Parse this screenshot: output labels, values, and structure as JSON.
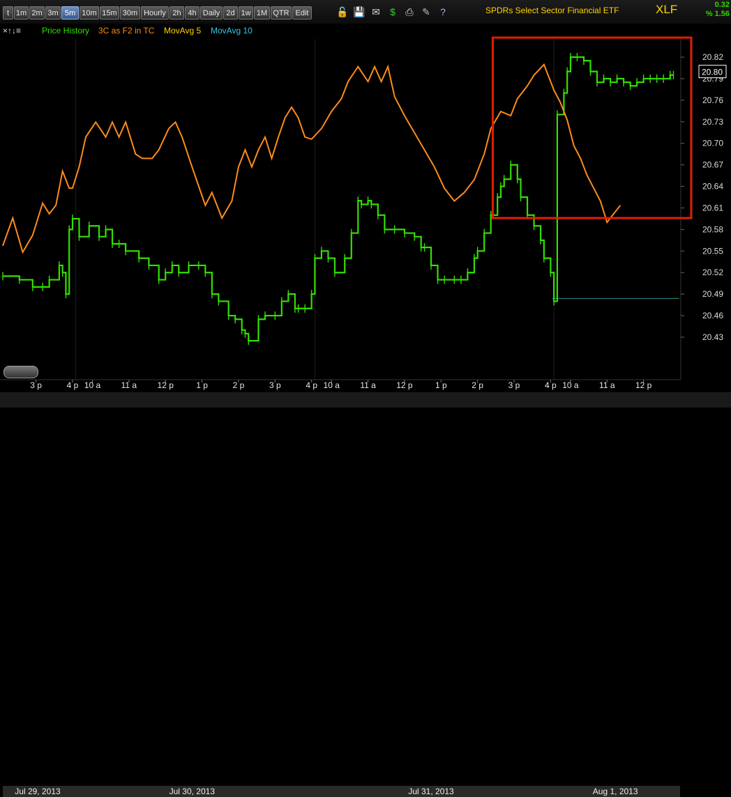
{
  "toolbar": {
    "timeframes": [
      "t",
      "1m",
      "2m",
      "3m",
      "5m",
      "10m",
      "15m",
      "30m",
      "Hourly",
      "2h",
      "4h",
      "Daily",
      "2d",
      "1w",
      "1M",
      "QTR",
      "Edit"
    ],
    "active": "5m",
    "icons": [
      "lock-icon",
      "save-icon",
      "mail-icon",
      "dollar-icon",
      "print-icon",
      "annotate-icon",
      "help-icon"
    ]
  },
  "header": {
    "title": "SPDRs Select Sector Financial ETF",
    "ticker": "XLF",
    "change": "0.32",
    "change_pct": "% 1.56"
  },
  "legend": {
    "items": [
      {
        "label": "Price History",
        "color": "#33e000"
      },
      {
        "label": "3C as F2 in TC",
        "color": "#ff8c1a"
      },
      {
        "label": "MovAvg 5",
        "color": "#ffd400"
      },
      {
        "label": "MovAvg 10",
        "color": "#36c8e8"
      }
    ]
  },
  "chart_data": {
    "type": "line",
    "price_axis": {
      "ticks": [
        "20.82",
        "20.79",
        "20.76",
        "20.73",
        "20.70",
        "20.67",
        "20.64",
        "20.61",
        "20.58",
        "20.55",
        "20.52",
        "20.49",
        "20.46",
        "20.43"
      ],
      "tick_values": [
        20.82,
        20.79,
        20.76,
        20.73,
        20.7,
        20.67,
        20.64,
        20.61,
        20.58,
        20.55,
        20.52,
        20.49,
        20.46,
        20.43
      ],
      "last_price": "20.80",
      "last_value": 20.8,
      "ylim": [
        20.4,
        20.84
      ]
    },
    "time_axis": {
      "ticks": [
        {
          "label": "3 p",
          "i": 10
        },
        {
          "label": "4 p",
          "i": 21
        },
        {
          "label": "10 a",
          "i": 27
        },
        {
          "label": "11 a",
          "i": 38
        },
        {
          "label": "12 p",
          "i": 49
        },
        {
          "label": "1 p",
          "i": 60
        },
        {
          "label": "2 p",
          "i": 71
        },
        {
          "label": "3 p",
          "i": 82
        },
        {
          "label": "4 p",
          "i": 93
        },
        {
          "label": "10 a",
          "i": 99
        },
        {
          "label": "11 a",
          "i": 110
        },
        {
          "label": "12 p",
          "i": 121
        },
        {
          "label": "1 p",
          "i": 132
        },
        {
          "label": "2 p",
          "i": 143
        },
        {
          "label": "3 p",
          "i": 154
        },
        {
          "label": "4 p",
          "i": 165
        },
        {
          "label": "10 a",
          "i": 171
        },
        {
          "label": "11 a",
          "i": 182
        },
        {
          "label": "12 p",
          "i": 193
        }
      ],
      "session_start_i": [
        22,
        94,
        166
      ],
      "bar_count": 204
    },
    "dates": [
      {
        "label": "Jul 29, 2013",
        "from": 0,
        "to": 21
      },
      {
        "label": "Jul 30, 2013",
        "from": 21,
        "to": 93
      },
      {
        "label": "Jul 31, 2013",
        "from": 93,
        "to": 165
      },
      {
        "label": "Aug 1, 2013",
        "from": 165,
        "to": 204
      }
    ],
    "price": [
      [
        0,
        20.515
      ],
      [
        5,
        20.51
      ],
      [
        9,
        20.5
      ],
      [
        12,
        20.5
      ],
      [
        14,
        20.51
      ],
      [
        17,
        20.53
      ],
      [
        18,
        20.52
      ],
      [
        19,
        20.49
      ],
      [
        20,
        20.58
      ],
      [
        21,
        20.595
      ],
      [
        23,
        20.57
      ],
      [
        26,
        20.585
      ],
      [
        29,
        20.57
      ],
      [
        31,
        20.58
      ],
      [
        33,
        20.56
      ],
      [
        35,
        20.56
      ],
      [
        37,
        20.55
      ],
      [
        41,
        20.54
      ],
      [
        44,
        20.53
      ],
      [
        47,
        20.51
      ],
      [
        49,
        20.52
      ],
      [
        51,
        20.53
      ],
      [
        53,
        20.52
      ],
      [
        56,
        20.53
      ],
      [
        59,
        20.53
      ],
      [
        61,
        20.52
      ],
      [
        63,
        20.49
      ],
      [
        65,
        20.48
      ],
      [
        68,
        20.46
      ],
      [
        70,
        20.455
      ],
      [
        72,
        20.44
      ],
      [
        73,
        20.435
      ],
      [
        74,
        20.425
      ],
      [
        77,
        20.455
      ],
      [
        79,
        20.46
      ],
      [
        82,
        20.46
      ],
      [
        84,
        20.48
      ],
      [
        86,
        20.49
      ],
      [
        88,
        20.47
      ],
      [
        89,
        20.47
      ],
      [
        91,
        20.47
      ],
      [
        93,
        20.49
      ],
      [
        94,
        20.54
      ],
      [
        96,
        20.55
      ],
      [
        98,
        20.54
      ],
      [
        100,
        20.52
      ],
      [
        103,
        20.54
      ],
      [
        105,
        20.575
      ],
      [
        107,
        20.62
      ],
      [
        108,
        20.615
      ],
      [
        110,
        20.62
      ],
      [
        111,
        20.615
      ],
      [
        113,
        20.6
      ],
      [
        115,
        20.58
      ],
      [
        118,
        20.58
      ],
      [
        121,
        20.575
      ],
      [
        124,
        20.57
      ],
      [
        126,
        20.555
      ],
      [
        127,
        20.555
      ],
      [
        129,
        20.53
      ],
      [
        131,
        20.51
      ],
      [
        133,
        20.51
      ],
      [
        136,
        20.51
      ],
      [
        138,
        20.51
      ],
      [
        140,
        20.52
      ],
      [
        142,
        20.54
      ],
      [
        143,
        20.55
      ],
      [
        145,
        20.575
      ],
      [
        147,
        20.6
      ],
      [
        149,
        20.625
      ],
      [
        150,
        20.64
      ],
      [
        151,
        20.65
      ],
      [
        153,
        20.67
      ],
      [
        155,
        20.65
      ],
      [
        156,
        20.625
      ],
      [
        158,
        20.6
      ],
      [
        160,
        20.585
      ],
      [
        162,
        20.565
      ],
      [
        163,
        20.54
      ],
      [
        165,
        20.52
      ],
      [
        166,
        20.48
      ],
      [
        167,
        20.74
      ],
      [
        169,
        20.77
      ],
      [
        170,
        20.8
      ],
      [
        171,
        20.82
      ],
      [
        173,
        20.82
      ],
      [
        175,
        20.815
      ],
      [
        177,
        20.8
      ],
      [
        179,
        20.785
      ],
      [
        181,
        20.79
      ],
      [
        183,
        20.785
      ],
      [
        185,
        20.79
      ],
      [
        187,
        20.785
      ],
      [
        189,
        20.78
      ],
      [
        191,
        20.785
      ],
      [
        193,
        20.79
      ],
      [
        195,
        20.79
      ],
      [
        197,
        20.79
      ],
      [
        199,
        20.79
      ],
      [
        201,
        20.795
      ],
      [
        202,
        20.795
      ]
    ],
    "cci_3c": [
      [
        0,
        0.35
      ],
      [
        3,
        0.48
      ],
      [
        6,
        0.32
      ],
      [
        9,
        0.4
      ],
      [
        12,
        0.55
      ],
      [
        14,
        0.5
      ],
      [
        16,
        0.54
      ],
      [
        18,
        0.7
      ],
      [
        20,
        0.62
      ],
      [
        21,
        0.62
      ],
      [
        23,
        0.72
      ],
      [
        25,
        0.86
      ],
      [
        28,
        0.93
      ],
      [
        31,
        0.86
      ],
      [
        33,
        0.93
      ],
      [
        35,
        0.86
      ],
      [
        37,
        0.93
      ],
      [
        40,
        0.78
      ],
      [
        42,
        0.76
      ],
      [
        45,
        0.76
      ],
      [
        47,
        0.8
      ],
      [
        50,
        0.9
      ],
      [
        52,
        0.93
      ],
      [
        54,
        0.86
      ],
      [
        57,
        0.72
      ],
      [
        59,
        0.63
      ],
      [
        61,
        0.54
      ],
      [
        63,
        0.6
      ],
      [
        66,
        0.48
      ],
      [
        69,
        0.56
      ],
      [
        71,
        0.72
      ],
      [
        73,
        0.8
      ],
      [
        75,
        0.72
      ],
      [
        77,
        0.8
      ],
      [
        79,
        0.86
      ],
      [
        81,
        0.76
      ],
      [
        83,
        0.86
      ],
      [
        85,
        0.95
      ],
      [
        87,
        1.0
      ],
      [
        89,
        0.95
      ],
      [
        91,
        0.86
      ],
      [
        93,
        0.85
      ],
      [
        96,
        0.9
      ],
      [
        99,
        0.98
      ],
      [
        102,
        1.04
      ],
      [
        104,
        1.12
      ],
      [
        107,
        1.19
      ],
      [
        110,
        1.12
      ],
      [
        112,
        1.19
      ],
      [
        114,
        1.12
      ],
      [
        116,
        1.19
      ],
      [
        118,
        1.05
      ],
      [
        121,
        0.96
      ],
      [
        124,
        0.88
      ],
      [
        127,
        0.8
      ],
      [
        130,
        0.72
      ],
      [
        133,
        0.62
      ],
      [
        136,
        0.56
      ],
      [
        139,
        0.6
      ],
      [
        142,
        0.66
      ],
      [
        145,
        0.78
      ],
      [
        147,
        0.9
      ],
      [
        150,
        0.98
      ],
      [
        153,
        0.96
      ],
      [
        155,
        1.04
      ],
      [
        158,
        1.1
      ],
      [
        160,
        1.15
      ],
      [
        163,
        1.2
      ],
      [
        165,
        1.12
      ],
      [
        166,
        1.08
      ],
      [
        168,
        1.02
      ],
      [
        170,
        0.94
      ],
      [
        172,
        0.82
      ],
      [
        174,
        0.76
      ],
      [
        176,
        0.68
      ],
      [
        178,
        0.62
      ],
      [
        180,
        0.56
      ],
      [
        182,
        0.46
      ],
      [
        184,
        0.5
      ],
      [
        186,
        0.54
      ]
    ],
    "ma10": {
      "from": 165,
      "to": 204,
      "value": 20.484
    },
    "box_from": 148,
    "box_to": 204
  }
}
